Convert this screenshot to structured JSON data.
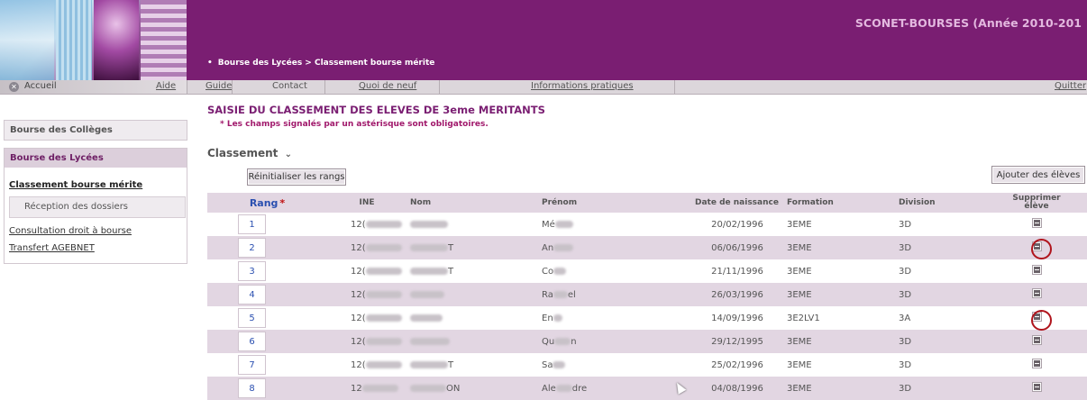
{
  "header": {
    "app_title": "SCONET-BOURSES (Année 2010-201",
    "breadcrumb": "Bourse des Lycées > Classement bourse mérite"
  },
  "nav": {
    "home": "Accueil",
    "help": "Aide",
    "items": [
      "Guide",
      "Contact",
      "Quoi de neuf",
      "Informations pratiques"
    ],
    "quit": "Quitter"
  },
  "sidebar": {
    "colleges": "Bourse des Collèges",
    "lycees": "Bourse des Lycées",
    "classement": "Classement bourse mérite",
    "reception": "Réception des dossiers",
    "consultation": "Consultation droit à bourse",
    "transfert": "Transfert AGEBNET"
  },
  "main": {
    "title": "SAISIE DU CLASSEMENT DES ELEVES DE 3eme MERITANTS",
    "mandatory_note": "* Les champs signalés par un astérisque sont obligatoires.",
    "section": "Classement",
    "section_toggle": "⌄",
    "reset_button": "Réinitialiser les rangs",
    "add_button": "Ajouter des élèves"
  },
  "table": {
    "headers": {
      "rang": "Rang",
      "rang_star": "*",
      "ine": "INE",
      "nom": "Nom",
      "prenom": "Prénom",
      "birth": "Date de naissance",
      "formation": "Formation",
      "division": "Division",
      "delete_line1": "Supprimer",
      "delete_line2": "élève"
    },
    "rows": [
      {
        "rang": "1",
        "ine": "12(",
        "prenom": "Mé",
        "birth": "20/02/1996",
        "formation": "3EME",
        "division": "3D"
      },
      {
        "rang": "2",
        "ine": "12(",
        "nom_suffix": "T",
        "prenom": "An",
        "birth": "06/06/1996",
        "formation": "3EME",
        "division": "3D"
      },
      {
        "rang": "3",
        "ine": "12(",
        "nom_suffix": "T",
        "prenom": "Co",
        "birth": "21/11/1996",
        "formation": "3EME",
        "division": "3D"
      },
      {
        "rang": "4",
        "ine": "12(",
        "prenom": "Ra",
        "prenom_suffix": "el",
        "birth": "26/03/1996",
        "formation": "3EME",
        "division": "3D"
      },
      {
        "rang": "5",
        "ine": "12(",
        "prenom": "En",
        "birth": "14/09/1996",
        "formation": "3E2LV1",
        "division": "3A"
      },
      {
        "rang": "6",
        "ine": "12(",
        "prenom": "Qu",
        "prenom_suffix": "n",
        "birth": "29/12/1995",
        "formation": "3EME",
        "division": "3D"
      },
      {
        "rang": "7",
        "ine": "12(",
        "nom_suffix": "T",
        "prenom": "Sa",
        "birth": "25/02/1996",
        "formation": "3EME",
        "division": "3D"
      },
      {
        "rang": "8",
        "ine": "12",
        "nom_suffix": "ON",
        "prenom": "Ale",
        "prenom_suffix": "dre",
        "birth": "04/08/1996",
        "formation": "3EME",
        "division": "3D"
      }
    ]
  },
  "colors": {
    "header_bg": "#7a1e72",
    "row_alt": "#e2d6e2",
    "annotation_ring": "#b0141c"
  }
}
